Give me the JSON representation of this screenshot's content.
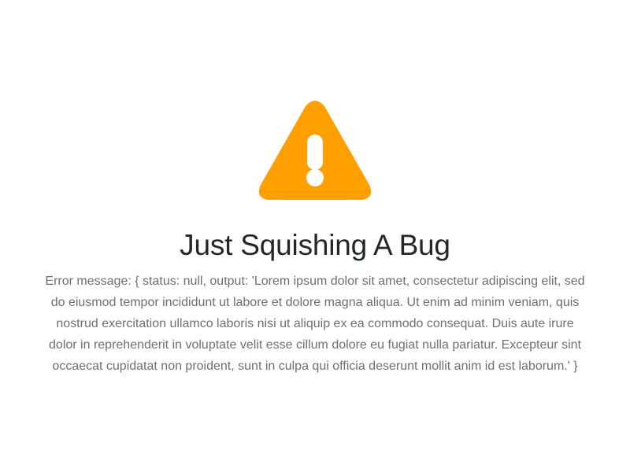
{
  "error_page": {
    "icon": "warning-icon",
    "icon_color": "#ff9f00",
    "title": "Just Squishing A Bug",
    "message": "Error message: { status: null, output: 'Lorem ipsum dolor sit amet, consectetur adipiscing elit, sed do eiusmod tempor incididunt ut labore et dolore magna aliqua. Ut enim ad minim veniam, quis nostrud exercitation ullamco laboris nisi ut aliquip ex ea commodo consequat. Duis aute irure dolor in reprehenderit in voluptate velit esse cillum dolore eu fugiat nulla pariatur. Excepteur sint occaecat cupidatat non proident, sunt in culpa qui officia deserunt mollit anim id est laborum.' }"
  }
}
